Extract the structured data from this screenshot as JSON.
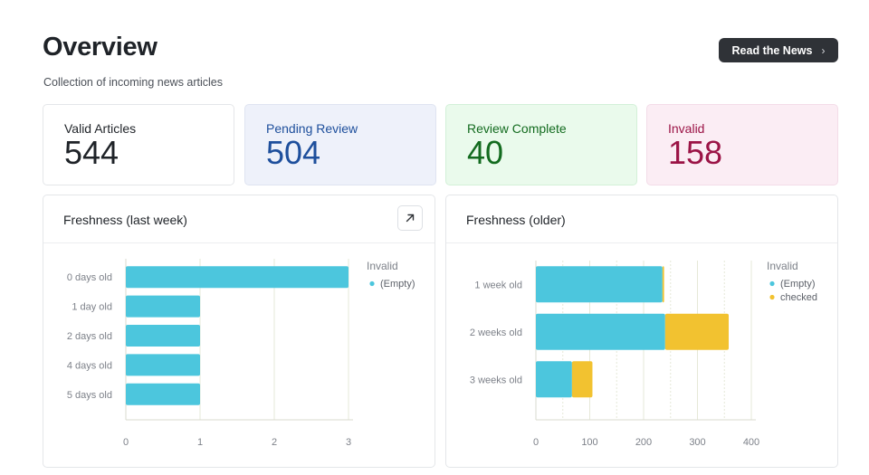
{
  "header": {
    "title": "Overview",
    "subtitle": "Collection of incoming news articles",
    "read_button_label": "Read the News"
  },
  "stats": [
    {
      "label": "Valid Articles",
      "value": "544"
    },
    {
      "label": "Pending Review",
      "value": "504"
    },
    {
      "label": "Review Complete",
      "value": "40"
    },
    {
      "label": "Invalid",
      "value": "158"
    }
  ],
  "colors": {
    "empty": "#4cc6dd",
    "checked": "#f2c230",
    "grid": "#e6e8d8",
    "tick_text": "#7d8189"
  },
  "icons": {
    "expand": "arrow-up-right-icon",
    "chevron": "chevron-right-icon"
  },
  "chart_data": [
    {
      "type": "bar",
      "orientation": "horizontal",
      "title": "Freshness (last week)",
      "categories": [
        "0 days old",
        "1 day old",
        "2 days old",
        "4 days old",
        "5 days old"
      ],
      "series": [
        {
          "name": "(Empty)",
          "color": "#4cc6dd",
          "values": [
            3,
            1,
            1,
            1,
            1
          ]
        }
      ],
      "legend_title": "Invalid",
      "xlim": [
        0,
        3
      ],
      "xticks": [
        "0",
        "1",
        "2",
        "3"
      ],
      "grid": true,
      "legend_position": "right"
    },
    {
      "type": "bar",
      "orientation": "horizontal",
      "stacked": true,
      "title": "Freshness (older)",
      "categories": [
        "1 week old",
        "2 weeks old",
        "3 weeks old"
      ],
      "series": [
        {
          "name": "(Empty)",
          "color": "#4cc6dd",
          "values": [
            235,
            240,
            67
          ]
        },
        {
          "name": "checked",
          "color": "#f2c230",
          "values": [
            3,
            118,
            38
          ]
        }
      ],
      "legend_title": "Invalid",
      "xlim": [
        0,
        400
      ],
      "xticks": [
        "0",
        "100",
        "200",
        "300",
        "400"
      ],
      "grid": true,
      "legend_position": "right"
    }
  ]
}
